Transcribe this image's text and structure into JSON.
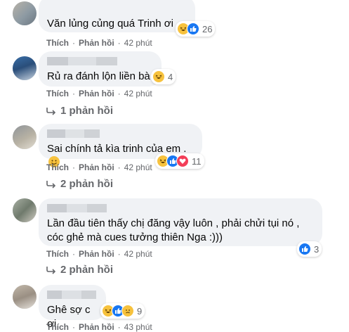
{
  "comments": [
    {
      "text": "Văn lủng củng quá Trinh ơi",
      "reactions": [
        "haha-icon",
        "like-icon"
      ],
      "reaction_count": "26"
    },
    {
      "text": "Rủ ra đánh lộn liền bà",
      "reactions": [
        "haha-icon"
      ],
      "reaction_count": "4",
      "action_like": "Thích",
      "action_reply": "Phản hồi",
      "time": "42 phút",
      "replies_label": "1 phản hồi"
    },
    {
      "text": "Sai chính tả kìa trinh của em .",
      "reactions": [
        "haha-icon",
        "like-icon",
        "love-icon"
      ],
      "reaction_count": "11",
      "action_like": "Thích",
      "action_reply": "Phản hồi",
      "time": "42 phút",
      "replies_label": "2 phản hồi"
    },
    {
      "text_line1": "Lần đầu tiên thấy chị đăng vậy luôn , phải chửi tụi nó ,",
      "text_line2": "cóc ghẻ mà cues tưởng thiên Nga :)))",
      "reactions": [
        "like-icon"
      ],
      "reaction_count": "3",
      "action_like": "Thích",
      "action_reply": "Phản hồi",
      "time": "42 phút",
      "replies_label": "2 phản hồi"
    },
    {
      "text": "Ghê sợ c ơi",
      "reactions": [
        "haha-icon",
        "like-icon",
        "sad-icon"
      ],
      "reaction_count": "9",
      "action_like": "Thích",
      "action_reply": "Phản hồi",
      "time": "43 phút"
    }
  ],
  "first_actions": {
    "action_like": "Thích",
    "action_reply": "Phản hồi",
    "time": "42 phút"
  },
  "separator": "·",
  "colors": {
    "bubble": "#f0f2f5",
    "meta_text": "#65676b",
    "like_blue": "#1877f2",
    "haha_yellow": "#f7c23d",
    "love_red": "#f33e58"
  }
}
